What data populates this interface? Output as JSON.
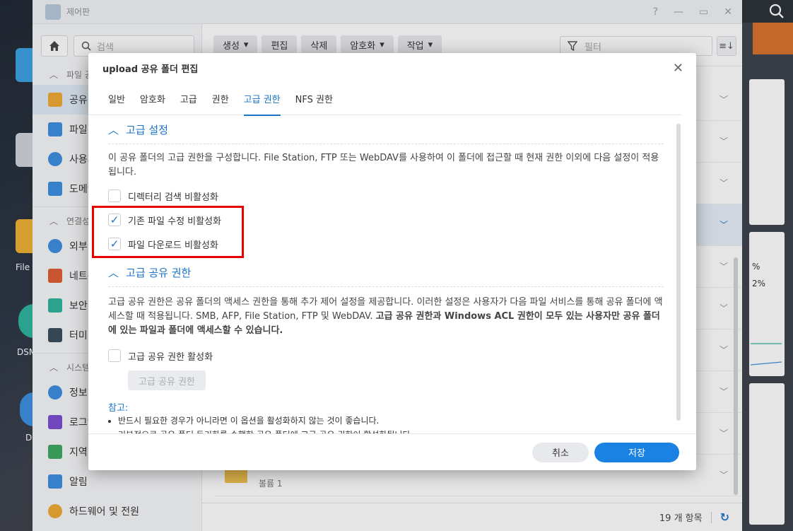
{
  "window": {
    "title": "제어판"
  },
  "sidebar": {
    "search_placeholder": "검색",
    "sections": [
      {
        "label": "파일 공유"
      },
      {
        "label": "연결성"
      },
      {
        "label": "시스템"
      }
    ],
    "items": [
      {
        "label": "공유 폴더",
        "color": "#f0a830"
      },
      {
        "label": "파일 서비스",
        "color": "#3a8de0"
      },
      {
        "label": "사용자 및 그룹",
        "color": "#3a8de0"
      },
      {
        "label": "도메인/LDAP",
        "color": "#3a8de0"
      },
      {
        "label": "외부 액세스",
        "color": "#3a8de0"
      },
      {
        "label": "네트워크",
        "color": "#e05a30"
      },
      {
        "label": "보안",
        "color": "#2cb39a"
      },
      {
        "label": "터미널 및 SNMP",
        "color": "#3a4a5a"
      },
      {
        "label": "정보 센터",
        "color": "#3a8de0"
      },
      {
        "label": "로그인 포털",
        "color": "#7a4ad0"
      },
      {
        "label": "지역 옵션",
        "color": "#3aa860"
      },
      {
        "label": "알림",
        "color": "#3a8de0"
      },
      {
        "label": "하드웨어 및 전원",
        "color": "#f0a830"
      }
    ]
  },
  "toolbar": {
    "create": "생성",
    "edit": "편집",
    "delete": "삭제",
    "encryption": "암호화",
    "action": "작업",
    "filter_placeholder": "필터"
  },
  "list": {
    "last_row_sub": "볼륨 1",
    "count_label": "19 개 항목"
  },
  "modal": {
    "title": "upload 공유 폴더 편집",
    "tabs": [
      "일반",
      "암호화",
      "고급",
      "권한",
      "고급 권한",
      "NFS 권한"
    ],
    "active_tab": "고급 권한",
    "section1": {
      "title": "고급 설정",
      "desc": "이 공유 폴더의 고급 권한을 구성합니다. File Station, FTP 또는 WebDAV를 사용하여 이 폴더에 접근할 때 현재 권한 이외에 다음 설정이 적용됩니다.",
      "options": [
        {
          "label": "디렉터리 검색 비활성화",
          "checked": false
        },
        {
          "label": "기존 파일 수정 비활성화",
          "checked": true
        },
        {
          "label": "파일 다운로드 비활성화",
          "checked": true
        }
      ]
    },
    "section2": {
      "title": "고급 공유 권한",
      "desc_plain": "고급 공유 권한은 공유 폴더의 액세스 권한을 통해 추가 제어 설정을 제공합니다. 이러한 설정은 사용자가 다음 파일 서비스를 통해 공유 폴더에 액세스할 때 적용됩니다. SMB, AFP, File Station, FTP 및 WebDAV. ",
      "desc_bold": "고급 공유 권한과 Windows ACL 권한이 모두 있는 사용자만 공유 폴더에 있는 파일과 폴더에 액세스할 수 있습니다.",
      "enable_label": "고급 공유 권한 활성화",
      "enable_checked": false,
      "button": "고급 공유 권한"
    },
    "note": {
      "title": "참고:",
      "items": [
        "반드시 필요한 경우가 아니라면 이 옵션을 활성화하지 않는 것이 좋습니다.",
        "기본적으로 공유 폴더 동기화를 수행한 공유 폴더에 고급 공유 권한이 활성화됩니다."
      ]
    },
    "cancel": "취소",
    "save": "저장"
  },
  "desktop": {
    "labels": [
      "File",
      "DSM",
      "D"
    ],
    "stats": [
      "%",
      "2%"
    ]
  },
  "colors": {
    "accent": "#1a73c9",
    "highlight_box": "#e60000"
  }
}
